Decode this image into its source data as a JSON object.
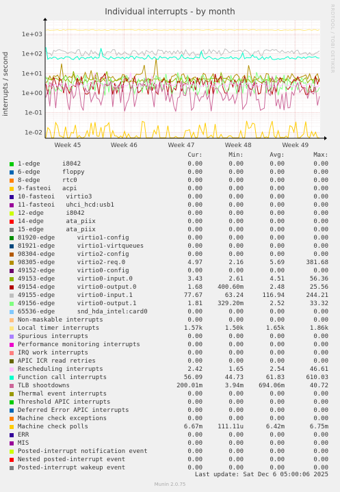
{
  "title": "Individual interrupts - by month",
  "watermark": "RRDTOOL / TOBI OETIKER",
  "last_update": "Last update: Sat Dec  6 05:00:06 2025",
  "footer": "Munin 2.0.75",
  "legend_headers": {
    "cur": "Cur:",
    "min": "Min:",
    "avg": "Avg:",
    "max": "Max:"
  },
  "chart_data": {
    "type": "line",
    "title": "Individual interrupts - by month",
    "ylabel": "interrupts / second",
    "yscale": "log",
    "ylim": [
      0.005,
      5000
    ],
    "yticks": [
      "1e-02",
      "1e-01",
      "1e+00",
      "1e+01",
      "1e+02",
      "1e+03"
    ],
    "xticks": [
      "Week 45",
      "Week 46",
      "Week 47",
      "Week 48",
      "Week 49"
    ],
    "grid": true,
    "series": [
      {
        "name": "1-edge      i8042",
        "color": "#00cc00",
        "cur": "0.00",
        "min": "0.00",
        "avg": "0.00",
        "max": "0.00"
      },
      {
        "name": "6-edge      floppy",
        "color": "#0066b3",
        "cur": "0.00",
        "min": "0.00",
        "avg": "0.00",
        "max": "0.00"
      },
      {
        "name": "8-edge      rtc0",
        "color": "#ff8000",
        "cur": "0.00",
        "min": "0.00",
        "avg": "0.00",
        "max": "0.00"
      },
      {
        "name": "9-fasteoi   acpi",
        "color": "#ffcc00",
        "cur": "0.00",
        "min": "0.00",
        "avg": "0.00",
        "max": "0.00"
      },
      {
        "name": "10-fasteoi   virtio3",
        "color": "#330099",
        "cur": "0.00",
        "min": "0.00",
        "avg": "0.00",
        "max": "0.00"
      },
      {
        "name": "11-fasteoi   uhci_hcd:usb1",
        "color": "#990099",
        "cur": "0.00",
        "min": "0.00",
        "avg": "0.00",
        "max": "0.00"
      },
      {
        "name": "12-edge      i8042",
        "color": "#ccff00",
        "cur": "0.00",
        "min": "0.00",
        "avg": "0.00",
        "max": "0.00"
      },
      {
        "name": "14-edge      ata_piix",
        "color": "#ff0000",
        "cur": "0.00",
        "min": "0.00",
        "avg": "0.00",
        "max": "0.00"
      },
      {
        "name": "15-edge      ata_piix",
        "color": "#808080",
        "cur": "0.00",
        "min": "0.00",
        "avg": "0.00",
        "max": "0.00"
      },
      {
        "name": "81920-edge      virtio1-config",
        "color": "#008f00",
        "cur": "0.00",
        "min": "0.00",
        "avg": "0.00",
        "max": "0.00"
      },
      {
        "name": "81921-edge      virtio1-virtqueues",
        "color": "#00487d",
        "cur": "0.00",
        "min": "0.00",
        "avg": "0.00",
        "max": "0.00"
      },
      {
        "name": "98304-edge      virtio2-config",
        "color": "#b35a00",
        "cur": "0.00",
        "min": "0.00",
        "avg": "0.00",
        "max": "0.00"
      },
      {
        "name": "98305-edge      virtio2-req.0",
        "color": "#b38f00",
        "cur": "4.97",
        "min": "2.16",
        "avg": "5.69",
        "max": "381.68"
      },
      {
        "name": "49152-edge      virtio0-config",
        "color": "#6b006b",
        "cur": "0.00",
        "min": "0.00",
        "avg": "0.00",
        "max": "0.00"
      },
      {
        "name": "49153-edge      virtio0-input.0",
        "color": "#8fb300",
        "cur": "3.43",
        "min": "2.61",
        "avg": "4.51",
        "max": "56.36"
      },
      {
        "name": "49154-edge      virtio0-output.0",
        "color": "#b30000",
        "cur": "1.68",
        "min": "400.60m",
        "avg": "2.48",
        "max": "25.56"
      },
      {
        "name": "49155-edge      virtio0-input.1",
        "color": "#bebebe",
        "cur": "77.67",
        "min": "63.24",
        "avg": "116.94",
        "max": "244.21"
      },
      {
        "name": "49156-edge      virtio0-output.1",
        "color": "#80ff80",
        "cur": "1.81",
        "min": "329.20m",
        "avg": "2.52",
        "max": "33.32"
      },
      {
        "name": "65536-edge      snd_hda_intel:card0",
        "color": "#80c9ff",
        "cur": "0.00",
        "min": "0.00",
        "avg": "0.00",
        "max": "0.00"
      },
      {
        "name": "Non-maskable interrupts",
        "color": "#ffc080",
        "cur": "0.00",
        "min": "0.00",
        "avg": "0.00",
        "max": "0.00"
      },
      {
        "name": "Local timer interrupts",
        "color": "#ffe680",
        "cur": "1.57k",
        "min": "1.50k",
        "avg": "1.65k",
        "max": "1.86k"
      },
      {
        "name": "Spurious interrupts",
        "color": "#aa80ff",
        "cur": "0.00",
        "min": "0.00",
        "avg": "0.00",
        "max": "0.00"
      },
      {
        "name": "Performance monitoring interrupts",
        "color": "#ee00cc",
        "cur": "0.00",
        "min": "0.00",
        "avg": "0.00",
        "max": "0.00"
      },
      {
        "name": "IRQ work interrupts",
        "color": "#ff8080",
        "cur": "0.00",
        "min": "0.00",
        "avg": "0.00",
        "max": "0.00"
      },
      {
        "name": "APIC ICR read retries",
        "color": "#666600",
        "cur": "0.00",
        "min": "0.00",
        "avg": "0.00",
        "max": "0.00"
      },
      {
        "name": "Rescheduling interrupts",
        "color": "#ffbfff",
        "cur": "2.42",
        "min": "1.65",
        "avg": "2.54",
        "max": "46.61"
      },
      {
        "name": "Function call interrupts",
        "color": "#00ffcc",
        "cur": "56.09",
        "min": "44.73",
        "avg": "61.83",
        "max": "610.03"
      },
      {
        "name": "TLB shootdowns",
        "color": "#cc6699",
        "cur": "200.01m",
        "min": "3.94m",
        "avg": "694.06m",
        "max": "40.72"
      },
      {
        "name": "Thermal event interrupts",
        "color": "#999900",
        "cur": "0.00",
        "min": "0.00",
        "avg": "0.00",
        "max": "0.00"
      },
      {
        "name": "Threshold APIC interrupts",
        "color": "#00cc00",
        "cur": "0.00",
        "min": "0.00",
        "avg": "0.00",
        "max": "0.00"
      },
      {
        "name": "Deferred Error APIC interrupts",
        "color": "#0066b3",
        "cur": "0.00",
        "min": "0.00",
        "avg": "0.00",
        "max": "0.00"
      },
      {
        "name": "Machine check exceptions",
        "color": "#ff8000",
        "cur": "0.00",
        "min": "0.00",
        "avg": "0.00",
        "max": "0.00"
      },
      {
        "name": "Machine check polls",
        "color": "#ffcc00",
        "cur": "6.67m",
        "min": "111.11u",
        "avg": "6.42m",
        "max": "6.75m"
      },
      {
        "name": "ERR",
        "color": "#330099",
        "cur": "0.00",
        "min": "0.00",
        "avg": "0.00",
        "max": "0.00"
      },
      {
        "name": "MIS",
        "color": "#990099",
        "cur": "0.00",
        "min": "0.00",
        "avg": "0.00",
        "max": "0.00"
      },
      {
        "name": "Posted-interrupt notification event",
        "color": "#ccff00",
        "cur": "0.00",
        "min": "0.00",
        "avg": "0.00",
        "max": "0.00"
      },
      {
        "name": "Nested posted-interrupt event",
        "color": "#ff0000",
        "cur": "0.00",
        "min": "0.00",
        "avg": "0.00",
        "max": "0.00"
      },
      {
        "name": "Posted-interrupt wakeup event",
        "color": "#808080",
        "cur": "0.00",
        "min": "0.00",
        "avg": "0.00",
        "max": "0.00"
      }
    ]
  }
}
